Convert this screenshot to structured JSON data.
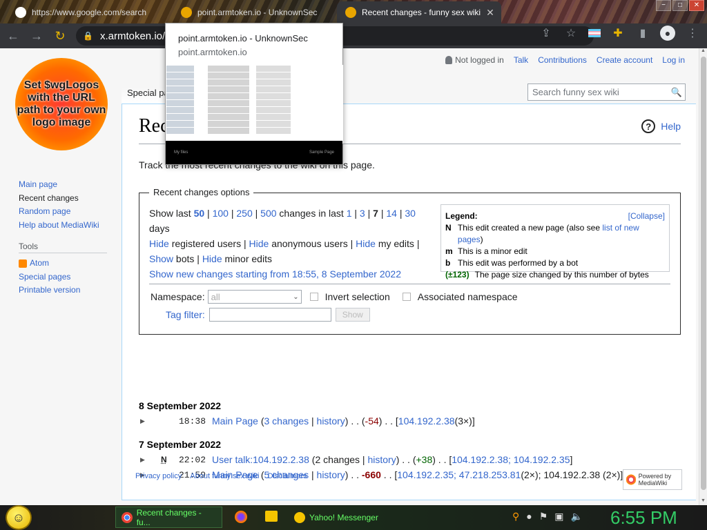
{
  "browser": {
    "tabs": [
      {
        "label": "https://www.google.com/search",
        "favicon_color": "#4285f4"
      },
      {
        "label": "point.armtoken.io - UnknownSec",
        "favicon_color": "#e8a500"
      },
      {
        "label": "Recent changes - funny sex wiki",
        "favicon_color": "#e8a500",
        "active": true
      }
    ],
    "url": "x.armtoken.io/w",
    "window_buttons": [
      "−",
      "□",
      "✕"
    ]
  },
  "popup": {
    "title": "point.armtoken.io - UnknownSec",
    "url": "point.armtoken.io",
    "footer_left": "My files",
    "footer_right": "Sample Page"
  },
  "wiki": {
    "logo_text": "Set $wgLogos with the URL path to your own logo image",
    "personal": {
      "not_logged_in": "Not logged in",
      "talk": "Talk",
      "contributions": "Contributions",
      "create_account": "Create account",
      "login": "Log in"
    },
    "namespace_tab": "Special page",
    "search_placeholder": "Search funny sex wiki",
    "sidebar": {
      "nav": [
        "Main page",
        "Recent changes",
        "Random page",
        "Help about MediaWiki"
      ],
      "tools_heading": "Tools",
      "tools": [
        "Atom",
        "Special pages",
        "Printable version"
      ]
    },
    "page_title": "Recent changes",
    "help": "Help",
    "intro": "Track the most recent changes to the wiki on this page.",
    "options": {
      "legend": "Recent changes options",
      "show_last": "Show last",
      "limits": [
        "50",
        "100",
        "250",
        "500"
      ],
      "changes_in_last": "changes in last",
      "days_opts": [
        "1",
        "3",
        "7",
        "14",
        "30"
      ],
      "days": "days",
      "hide": "Hide",
      "show": "Show",
      "registered_users": "registered users",
      "anonymous_users": "anonymous users",
      "my_edits": "my edits",
      "bots": "bots",
      "minor_edits": "minor edits",
      "new_changes_link": "Show new changes starting from 18:55, 8 September 2022",
      "namespace_label": "Namespace:",
      "namespace_value": "all",
      "invert": "Invert selection",
      "associated": "Associated namespace",
      "tag_filter": "Tag filter:",
      "show_button": "Show"
    },
    "legend": {
      "title": "Legend:",
      "collapse": "[Collapse]",
      "rows": [
        {
          "key": "N",
          "text": "This edit created a new page (also see ",
          "link": "list of new pages",
          "after": ")"
        },
        {
          "key": "m",
          "text": "This is a minor edit",
          "link": "",
          "after": ""
        },
        {
          "key": "b",
          "text": "This edit was performed by a bot",
          "link": "",
          "after": ""
        },
        {
          "key": "(±123)",
          "text": "The page size changed by this number of bytes",
          "link": "",
          "after": ""
        }
      ]
    },
    "days_list": [
      {
        "date": "8 September 2022",
        "rows": [
          {
            "flag": "",
            "time": "18:38",
            "page": "Main Page",
            "changes": "3 changes",
            "history": "history",
            "diff": "-54",
            "diff_class": "neg",
            "users": "104.192.2.38",
            "users_suffix": " (3×)"
          }
        ]
      },
      {
        "date": "7 September 2022",
        "rows": [
          {
            "flag": "N",
            "time": "22:02",
            "page": "User talk:104.192.2.38",
            "changes": "2 changes",
            "history": "history",
            "diff": "+38",
            "diff_class": "pos",
            "users": "104.192.2.38; 104.192.2.35",
            "users_suffix": ""
          },
          {
            "flag": "",
            "time": "21:59",
            "page": "Main Page",
            "changes": "5 changes",
            "history": "history",
            "diff": "-660",
            "diff_class": "negb",
            "users": "104.192.2.35; 47.218.253.81",
            "users_suffix": " (2×); 104.192.2.38 (2×)"
          }
        ]
      }
    ],
    "footer": [
      "Privacy policy",
      "About funny sex wiki",
      "Disclaimers"
    ],
    "powered_by": "Powered by MediaWiki"
  },
  "taskbar": {
    "items": [
      "Recent changes - fu...",
      "Yahoo! Messenger"
    ],
    "clock": "6:55 PM"
  }
}
